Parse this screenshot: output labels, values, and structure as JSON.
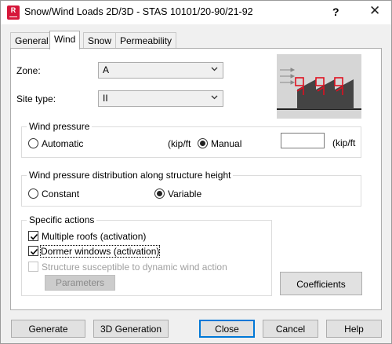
{
  "window": {
    "title": "Snow/Wind Loads 2D/3D - STAS 10101/20-90/21-92",
    "app_icon_letter": "R",
    "help_label": "?",
    "close_label": "✕"
  },
  "tabs": [
    {
      "label": "General",
      "active": false
    },
    {
      "label": "Wind",
      "active": true
    },
    {
      "label": "Snow",
      "active": false
    },
    {
      "label": "Permeability",
      "active": false
    }
  ],
  "wind_tab": {
    "zone": {
      "label": "Zone:",
      "value": "A"
    },
    "site_type": {
      "label": "Site type:",
      "value": "II"
    },
    "wind_pressure": {
      "title": "Wind pressure",
      "automatic_label": "Automatic",
      "automatic_unit": "(kip/ft",
      "manual_label": "Manual",
      "manual_value": "",
      "manual_unit": "(kip/ft",
      "selected": "manual"
    },
    "distribution": {
      "title": "Wind pressure distribution along structure height",
      "constant_label": "Constant",
      "variable_label": "Variable",
      "selected": "variable"
    },
    "specific_actions": {
      "title": "Specific actions",
      "multiple_roofs_label": "Multiple roofs (activation)",
      "multiple_roofs_checked": true,
      "dormer_windows_label": "Dormer windows (activation)",
      "dormer_windows_checked": true,
      "dynamic_label": "Structure susceptible to dynamic wind action",
      "dynamic_checked": false,
      "dynamic_enabled": false,
      "parameters_label": "Parameters"
    },
    "coefficients_label": "Coefficients"
  },
  "buttons": {
    "generate": "Generate",
    "generation_3d": "3D Generation",
    "close": "Close",
    "cancel": "Cancel",
    "help": "Help"
  },
  "colors": {
    "accent_focus": "#0078d7",
    "app_icon": "#d6173a",
    "preview_highlight": "#e01020"
  },
  "icons": [
    "robot-app-icon",
    "chevron-down-icon",
    "checkmark-icon",
    "wind-structure-preview"
  ]
}
